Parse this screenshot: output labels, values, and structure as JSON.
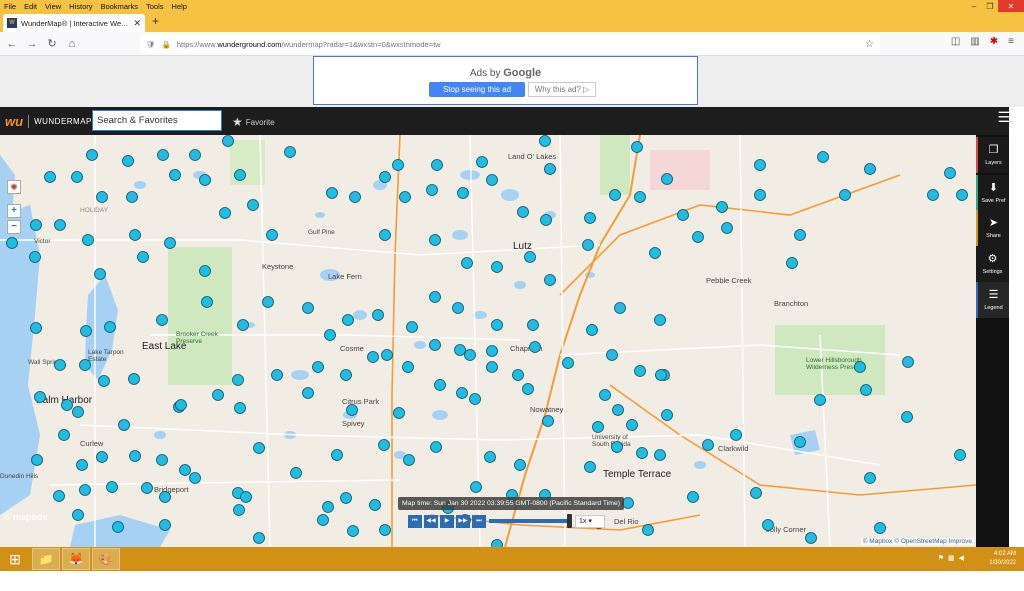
{
  "menu": [
    "File",
    "Edit",
    "View",
    "History",
    "Bookmarks",
    "Tools",
    "Help"
  ],
  "window_controls": {
    "minimize": "–",
    "restore": "❐",
    "close": "✕"
  },
  "tab": {
    "title": "WunderMap® | Interactive We...",
    "close": "✕",
    "new": "+"
  },
  "nav": {
    "back": "←",
    "forward": "→",
    "reload": "↻",
    "home": "⌂",
    "url_prefix": "https://www.",
    "url_host": "wunderground.com",
    "url_rest": "/wundermap?radar=1&wxstn=0&wxstnmode=tw",
    "star": "☆"
  },
  "ad": {
    "ads_by": "Ads by",
    "google": "Google",
    "stop": "Stop seeing this ad",
    "why": "Why this ad? ▷"
  },
  "header": {
    "logo_name": "WUNDERMAP",
    "search_value": "Search & Favorites",
    "favorite": "Favorite",
    "menu_icon": "☰"
  },
  "map": {
    "zoom_in": "+",
    "zoom_out": "−",
    "labels": {
      "east_lake": "East Lake",
      "palm_harbor": "Palm Harbor",
      "lutz": "Lutz",
      "temple_terrace": "Temple Terrace",
      "keystone": "Keystone",
      "lake_fern": "Lake Fern",
      "land_o_lakes": "Land O' Lakes",
      "cosme": "Cosme",
      "citrus_park": "Citrus Park",
      "spivey": "Spivey",
      "chapman": "Chapman",
      "nowatney": "Nowatney",
      "pebble_creek": "Pebble Creek",
      "branchton": "Branchton",
      "clarkwild": "Clarkwild",
      "curlew": "Curlew",
      "dunedin": "Dunedin Hills",
      "bridgeport": "Bridgeport",
      "del_rio": "Del Rio",
      "jolly_corner": "Jolly Corner",
      "brooker": "Brooker Creek Preserve",
      "lower_hills": "Lower Hillsborough Wilderness Preserve",
      "victor": "Victor",
      "wall_springs": "Wall Springs",
      "lake_tarpon": "Lake Tarpon Estate",
      "holiday": "HOLIDAY",
      "gulf_pine": "Gulf Pine",
      "univ": "University of South Florida"
    },
    "mapbox": "© mapbox",
    "attribution": "© Mapbox © OpenStreetMap Improve"
  },
  "timeline": {
    "tooltip": "Map time: Sun Jan 30 2022 03:39:55 GMT-0800 (Pacific Standard Time)",
    "speed": "1x ▾",
    "progress": 0.95,
    "buttons": [
      "⏮",
      "◀◀",
      "▶",
      "▶▶",
      "⏭"
    ]
  },
  "sidebar": {
    "layers": "Layers",
    "save_pref": "Save Pref",
    "share": "Share",
    "settings": "Settings",
    "legend": "Legend"
  },
  "taskbar": {
    "time": "4:02 AM",
    "date": "1/30/2022"
  },
  "colors": {
    "station": "#1fbde0",
    "water": "#a7d1f2",
    "park": "#c8e6b6",
    "highway": "#f39c3b",
    "taskbar": "#d19116"
  }
}
